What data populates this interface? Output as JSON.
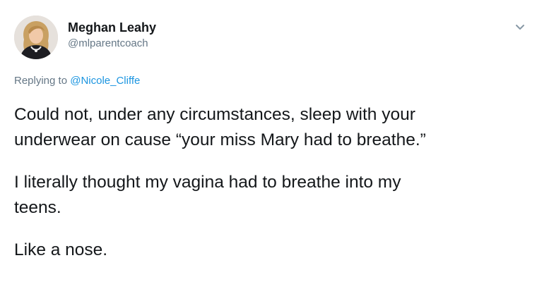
{
  "tweet": {
    "author": {
      "display_name": "Meghan Leahy",
      "handle": "@mlparentcoach"
    },
    "reply": {
      "prefix": "Replying to ",
      "mention": "@Nicole_Cliffe"
    },
    "paragraphs": [
      "Could not, under any circumstances, sleep with your\nunderwear on cause “your miss Mary had to breathe.”",
      "I literally thought my vagina had to breathe into my\nteens.",
      "Like a nose."
    ],
    "icons": {
      "avatar": "user-avatar-photo",
      "menu": "chevron-down-icon"
    },
    "colors": {
      "text": "#14171a",
      "secondary": "#657786",
      "link": "#1b95e0",
      "background": "#ffffff"
    }
  }
}
